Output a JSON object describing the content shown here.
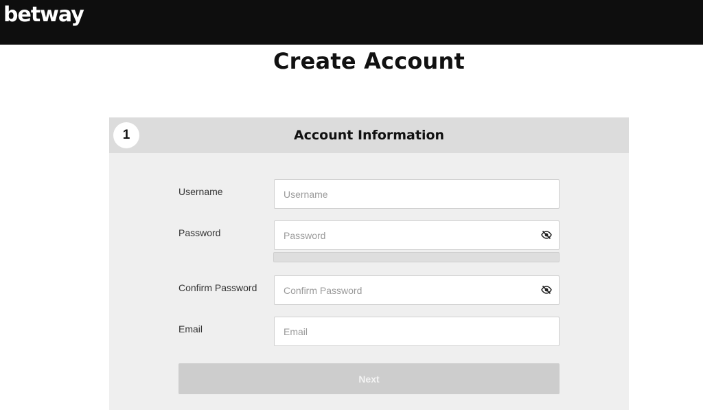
{
  "header": {
    "logo_text": "betway"
  },
  "page": {
    "title": "Create Account"
  },
  "step": {
    "number": "1",
    "title": "Account Information"
  },
  "form": {
    "username": {
      "label": "Username",
      "placeholder": "Username",
      "value": ""
    },
    "password": {
      "label": "Password",
      "placeholder": "Password",
      "value": "",
      "toggle_icon": "eye-slash-icon"
    },
    "password_strength": 0,
    "confirm_password": {
      "label": "Confirm Password",
      "placeholder": "Confirm Password",
      "value": "",
      "toggle_icon": "eye-slash-icon"
    },
    "email": {
      "label": "Email",
      "placeholder": "Email",
      "value": ""
    },
    "next_label": "Next"
  },
  "colors": {
    "topbar": "#0e0e0e",
    "panel": "#efefef",
    "panel_header": "#dcdcdc",
    "button_disabled": "#cdcdcd"
  }
}
